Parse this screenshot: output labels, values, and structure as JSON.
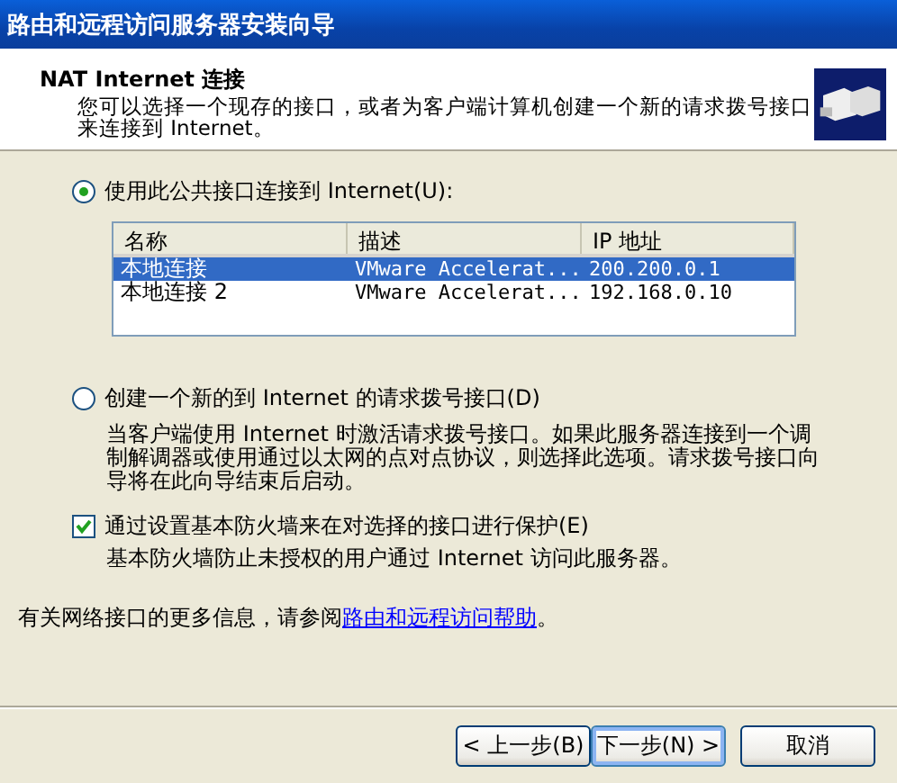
{
  "window": {
    "title": "路由和远程访问服务器安装向导"
  },
  "header": {
    "title": "NAT Internet 连接",
    "subtitle": "您可以选择一个现存的接口，或者为客户端计算机创建一个新的请求拨号接口来连接到 Internet。"
  },
  "options": [
    {
      "kind": "radio",
      "label": "使用此公共接口连接到 Internet(U):",
      "selected": true
    },
    {
      "kind": "radio",
      "label": "创建一个新的到 Internet 的请求拨号接口(D)",
      "selected": false,
      "description": "当客户端使用 Internet 时激活请求拨号接口。如果此服务器连接到一个调制解调器或使用通过以太网的点对点协议，则选择此选项。请求拨号接口向导将在此向导结束后启动。"
    },
    {
      "kind": "checkbox",
      "label": "通过设置基本防火墙来在对选择的接口进行保护(E)",
      "checked": true,
      "description": "基本防火墙防止未授权的用户通过 Internet 访问此服务器。"
    }
  ],
  "table": {
    "columns": [
      "名称",
      "描述",
      "IP 地址"
    ],
    "rows": [
      {
        "cells": [
          "本地连接",
          "VMware Accelerat...",
          "200.200.0.1"
        ],
        "selected": true
      },
      {
        "cells": [
          "本地连接 2",
          "VMware Accelerat...",
          "192.168.0.10"
        ],
        "selected": false
      }
    ]
  },
  "help": {
    "text": "有关网络接口的更多信息，请参阅",
    "link": "路由和远程访问帮助",
    "after": "。"
  },
  "buttons": [
    {
      "label": "< 上一步(B)",
      "default": false
    },
    {
      "label": "下一步(N) >",
      "default": true
    },
    {
      "label": "取消",
      "default": false
    }
  ]
}
